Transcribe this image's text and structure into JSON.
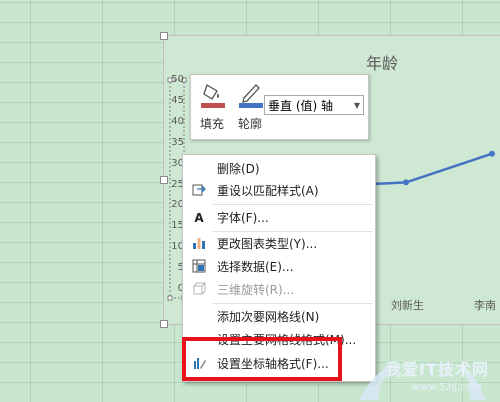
{
  "chart": {
    "title": "年龄",
    "y_ticks": [
      "50",
      "45",
      "40",
      "35",
      "30",
      "25",
      "20",
      "15",
      "10",
      "5",
      "0"
    ],
    "x_ticks": [
      "刘新生",
      "李南"
    ],
    "line_color": "#4472c4"
  },
  "chart_data": {
    "type": "line",
    "title": "年龄",
    "categories": [
      "",
      "",
      "",
      "",
      "刘新生",
      "李南"
    ],
    "series": [
      {
        "values": [
          null,
          null,
          null,
          25,
          26,
          33
        ]
      }
    ],
    "ylim": [
      0,
      50
    ],
    "grid": false
  },
  "mini_toolbar": {
    "fill_label": "填充",
    "outline_label": "轮廓",
    "fill_icon": "paint-bucket-icon",
    "outline_icon": "pen-icon",
    "fill_color": "#c0504d",
    "outline_color": "#4472c4",
    "element_select": "垂直 (值) 轴"
  },
  "context_menu": {
    "items": [
      {
        "label": "删除(D)",
        "icon": "",
        "disabled": false
      },
      {
        "label": "重设以匹配样式(A)",
        "icon": "reset-style-icon",
        "disabled": false
      },
      {
        "label": "字体(F)...",
        "icon": "font-icon",
        "disabled": false
      },
      {
        "label": "更改图表类型(Y)...",
        "icon": "chart-type-icon",
        "disabled": false
      },
      {
        "label": "选择数据(E)...",
        "icon": "select-data-icon",
        "disabled": false
      },
      {
        "label": "三维旋转(R)...",
        "icon": "rotate-3d-icon",
        "disabled": true
      },
      {
        "label": "添加次要网格线(N)",
        "icon": "",
        "disabled": false
      },
      {
        "label": "设置主要网格线格式(M)...",
        "icon": "",
        "disabled": false
      },
      {
        "label": "设置坐标轴格式(F)...",
        "icon": "format-axis-icon",
        "disabled": false
      }
    ]
  },
  "watermark": {
    "title": "我爱IT技术网",
    "url": "www.52ij.com"
  }
}
